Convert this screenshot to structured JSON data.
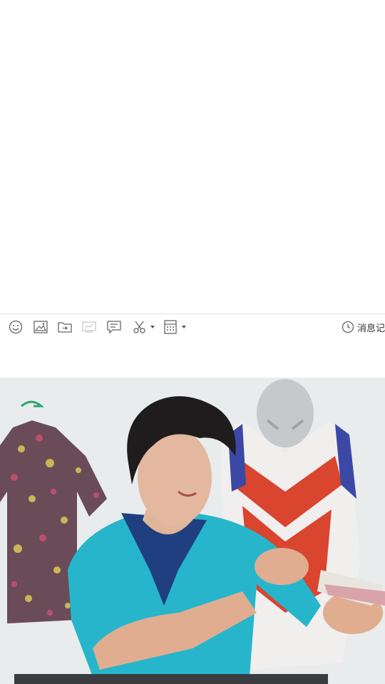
{
  "toolbar": {
    "icons": [
      {
        "name": "emoji-icon"
      },
      {
        "name": "image-icon"
      },
      {
        "name": "folder-icon"
      },
      {
        "name": "screen-share-icon"
      },
      {
        "name": "message-icon"
      },
      {
        "name": "scissors-icon"
      },
      {
        "name": "calculator-icon"
      }
    ],
    "history_label": "消息记"
  },
  "colors": {
    "toolbar_icon": "#666666",
    "disabled_icon": "#c8c8c8",
    "divider": "#e3e3e3",
    "wall": "#e8ecec",
    "shirt": "#27b5cc"
  }
}
